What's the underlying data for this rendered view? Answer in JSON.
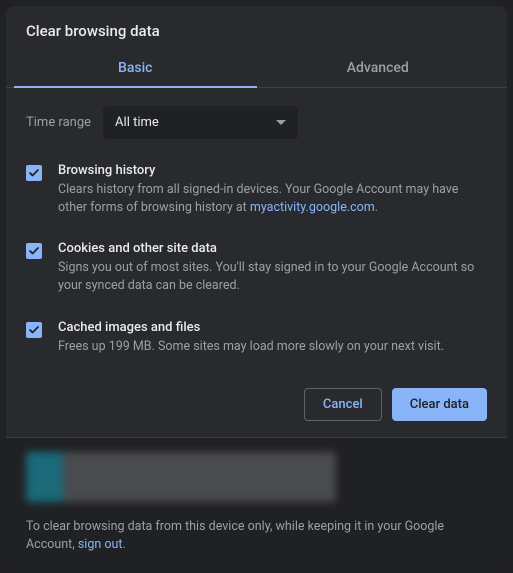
{
  "dialog": {
    "title": "Clear browsing data"
  },
  "tabs": {
    "basic": "Basic",
    "advanced": "Advanced"
  },
  "timeRange": {
    "label": "Time range",
    "value": "All time"
  },
  "options": {
    "browsingHistory": {
      "title": "Browsing history",
      "desc1": "Clears history from all signed-in devices. Your Google Account may have other forms of browsing history at ",
      "link": "myactivity.google.com",
      "desc2": "."
    },
    "cookies": {
      "title": "Cookies and other site data",
      "desc": "Signs you out of most sites. You'll stay signed in to your Google Account so your synced data can be cleared."
    },
    "cache": {
      "title": "Cached images and files",
      "desc": "Frees up 199 MB. Some sites may load more slowly on your next visit."
    }
  },
  "buttons": {
    "cancel": "Cancel",
    "clear": "Clear data"
  },
  "footer": {
    "text1": "To clear browsing data from this device only, while keeping it in your Google Account, ",
    "link": "sign out",
    "text2": "."
  }
}
